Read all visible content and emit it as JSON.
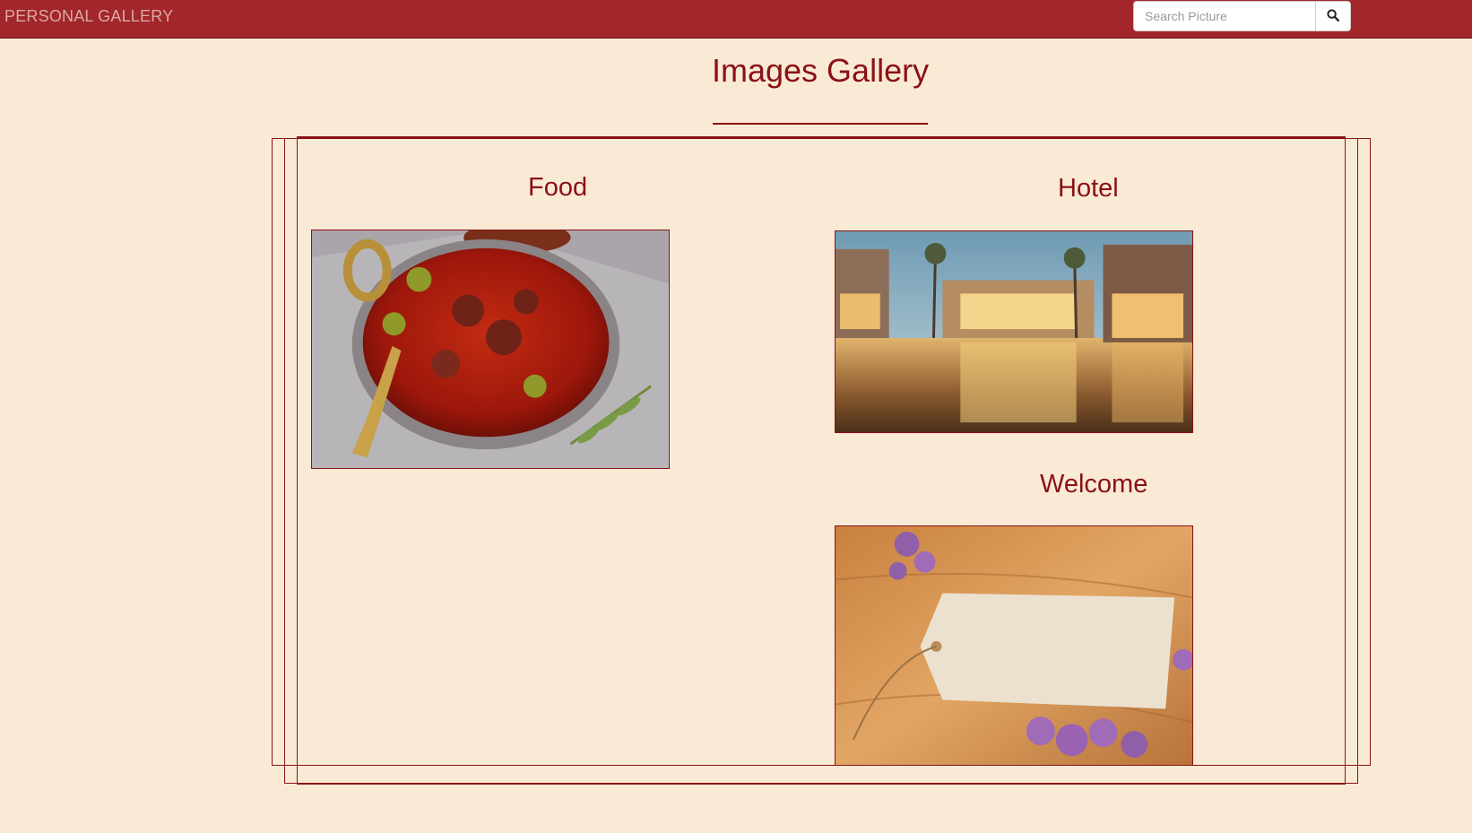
{
  "navbar": {
    "brand": "PERSONAL GALLERY",
    "search": {
      "placeholder": "Search Picture",
      "value": ""
    },
    "search_icon": "magnifier-icon"
  },
  "page": {
    "title": "Images Gallery"
  },
  "gallery": {
    "items": [
      {
        "title": "Food",
        "image": "food-curry-dish-image"
      },
      {
        "title": "Hotel",
        "image": "hotel-resort-pool-image"
      },
      {
        "title": "Welcome",
        "image": "welcome-tag-image"
      }
    ]
  },
  "colors": {
    "navbar_bg": "#a2262a",
    "page_bg": "#f9ead6",
    "accent": "#8b1114"
  }
}
